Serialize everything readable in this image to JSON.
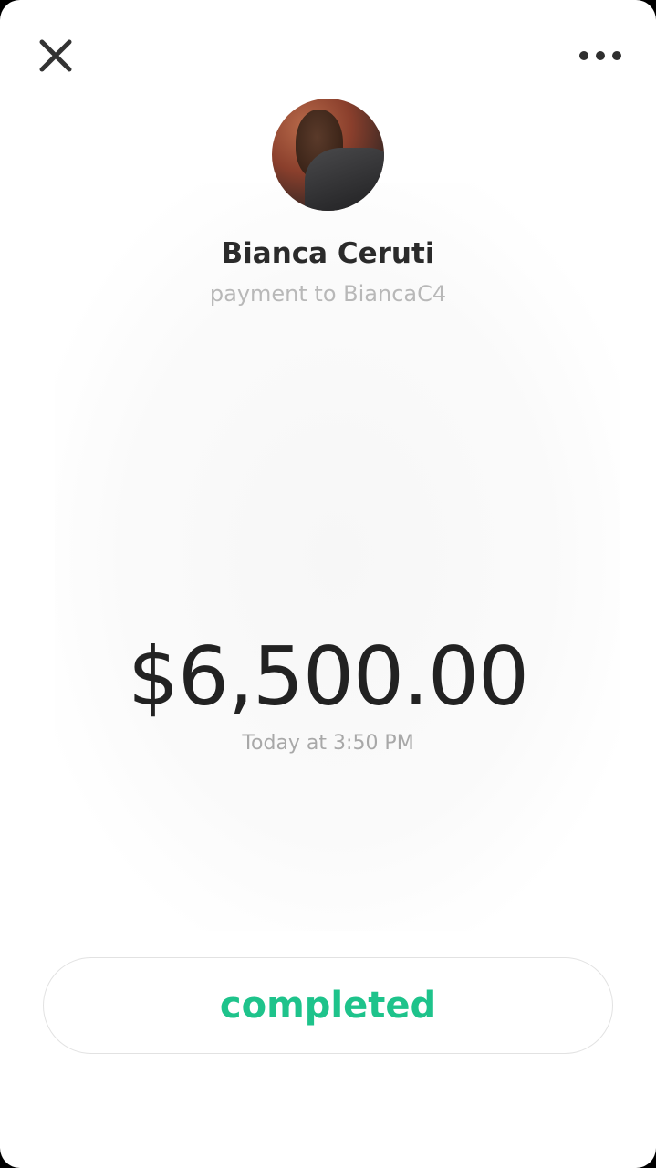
{
  "header": {
    "close_icon": "close-icon",
    "more_icon": "more-options-icon"
  },
  "recipient": {
    "name": "Bianca Ceruti",
    "subtitle": "payment to BiancaC4"
  },
  "payment": {
    "amount": "$6,500.00",
    "timestamp": "Today at 3:50 PM",
    "status": "completed"
  },
  "colors": {
    "status": "#1ec38b",
    "text_primary": "#222222",
    "text_secondary": "#b8b8b8",
    "background": "#ffffff"
  }
}
